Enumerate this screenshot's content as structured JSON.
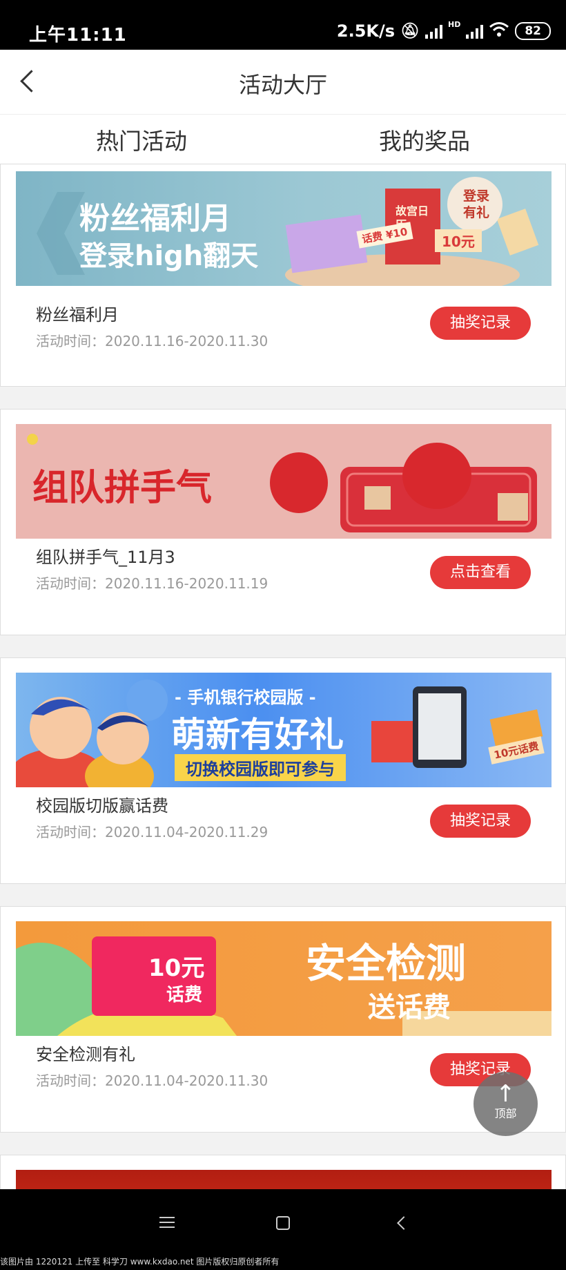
{
  "status_bar": {
    "time": "上午11:11",
    "speed": "2.5K/s",
    "battery": "82",
    "network_label": "HD"
  },
  "header": {
    "title": "活动大厅"
  },
  "tabs": [
    {
      "label": "热门活动",
      "active": true
    },
    {
      "label": "我的奖品",
      "active": false
    }
  ],
  "activities": [
    {
      "banner": {
        "line1": "粉丝福利月",
        "line2": "登录high翻天",
        "badge": "登录有礼",
        "coupon": "10元",
        "ticket": "话费 ¥10",
        "book": "故宫日历"
      },
      "name": "粉丝福利月",
      "period": "活动时间：2020.11.16-2020.11.30",
      "button": "抽奖记录"
    },
    {
      "banner": {
        "line1": "组队拼手气"
      },
      "name": "组队拼手气_11月3",
      "period": "活动时间：2020.11.16-2020.11.19",
      "button": "点击查看"
    },
    {
      "banner": {
        "line0": "- 手机银行校园版 -",
        "line1": "萌新有好礼",
        "line2": "切换校园版即可参与",
        "coupon": "10元话费"
      },
      "name": "校园版切版赢话费",
      "period": "活动时间：2020.11.04-2020.11.29",
      "button": "抽奖记录"
    },
    {
      "banner": {
        "line1": "安全检测",
        "line2": "送话费",
        "coupon_amount": "10元",
        "coupon_unit": "话费"
      },
      "name": "安全检测有礼",
      "period": "活动时间：2020.11.04-2020.11.30",
      "button": "抽奖记录"
    }
  ],
  "back_to_top": {
    "label": "顶部"
  },
  "watermark": "该图片由 1220121 上传至 科学刀 www.kxdao.net 图片版权归原创者所有",
  "colors": {
    "accent": "#e63a3a",
    "tab_underline": "#d63131",
    "background": "#f2f2f2"
  }
}
